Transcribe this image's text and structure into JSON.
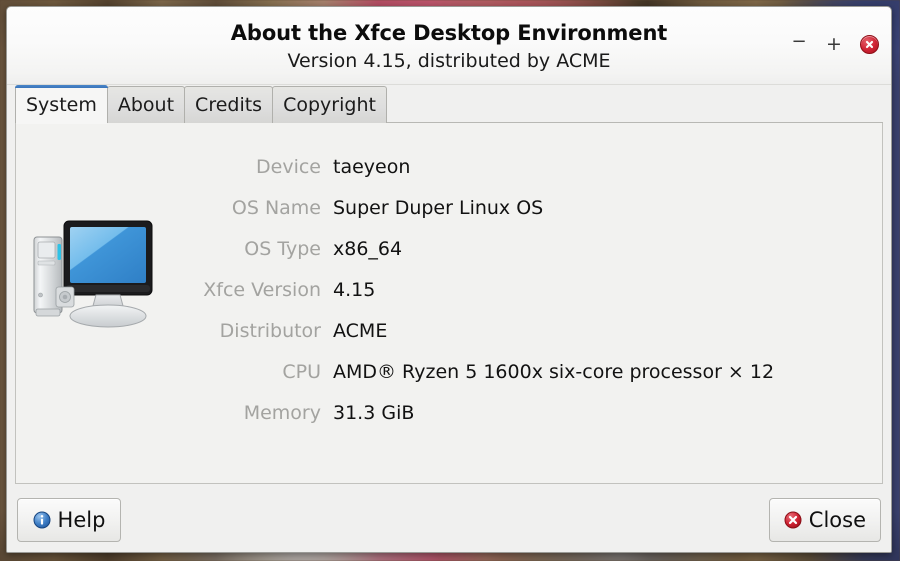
{
  "window": {
    "title": "About the Xfce Desktop Environment",
    "subtitle": "Version 4.15, distributed by ACME",
    "controls": {
      "minimize": "−",
      "maximize": "+",
      "close_icon": "close-circle-icon"
    }
  },
  "tabs": [
    {
      "label": "System",
      "active": true
    },
    {
      "label": "About",
      "active": false
    },
    {
      "label": "Credits",
      "active": false
    },
    {
      "label": "Copyright",
      "active": false
    }
  ],
  "system": {
    "icon": "computer-icon",
    "rows": [
      {
        "label": "Device",
        "value": "taeyeon"
      },
      {
        "label": "OS Name",
        "value": "Super Duper Linux OS"
      },
      {
        "label": "OS Type",
        "value": "x86_64"
      },
      {
        "label": "Xfce Version",
        "value": "4.15"
      },
      {
        "label": "Distributor",
        "value": "ACME"
      },
      {
        "label": "CPU",
        "value": "AMD® Ryzen 5 1600x six-core processor × 12"
      },
      {
        "label": "Memory",
        "value": "31.3 GiB"
      }
    ]
  },
  "actions": {
    "help": {
      "label": "Help",
      "icon": "info-icon"
    },
    "close": {
      "label": "Close",
      "icon": "close-circle-icon"
    }
  },
  "colors": {
    "accent_tab": "#3a74bb",
    "label_text": "#a3a3a0",
    "value_text": "#121212",
    "window_bg": "#f0f0ef",
    "content_bg": "#f2f2f0",
    "close_red": "#cf2233",
    "info_blue": "#3a74bb"
  }
}
